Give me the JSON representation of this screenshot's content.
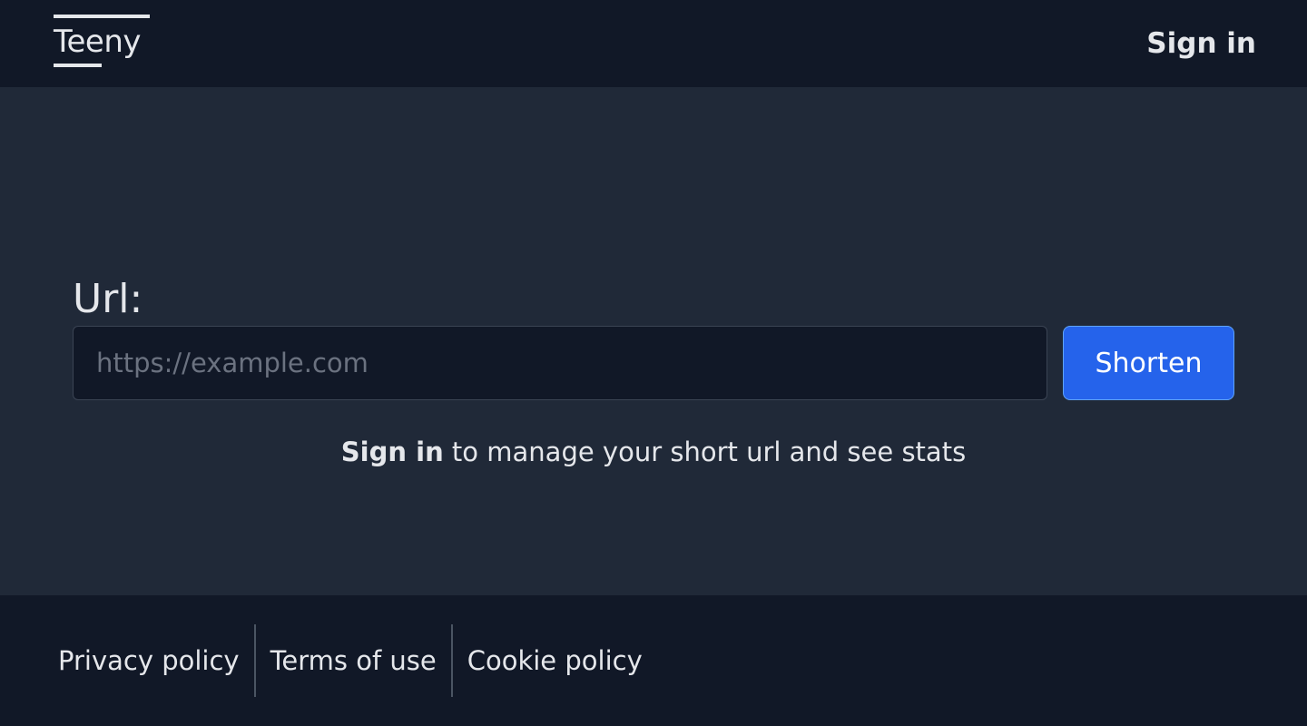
{
  "header": {
    "logo_text": "Teeny",
    "signin_label": "Sign in"
  },
  "form": {
    "label": "Url:",
    "input_value": "",
    "input_placeholder": "https://example.com",
    "submit_label": "Shorten"
  },
  "hint": {
    "signin_link": "Sign in",
    "text": " to manage your short url and see stats"
  },
  "footer": {
    "links": [
      {
        "label": "Privacy policy"
      },
      {
        "label": "Terms of use"
      },
      {
        "label": "Cookie policy"
      }
    ]
  },
  "colors": {
    "header_bg": "#111827",
    "main_bg": "#202938",
    "accent": "#2563eb",
    "text": "#e5e7eb"
  }
}
